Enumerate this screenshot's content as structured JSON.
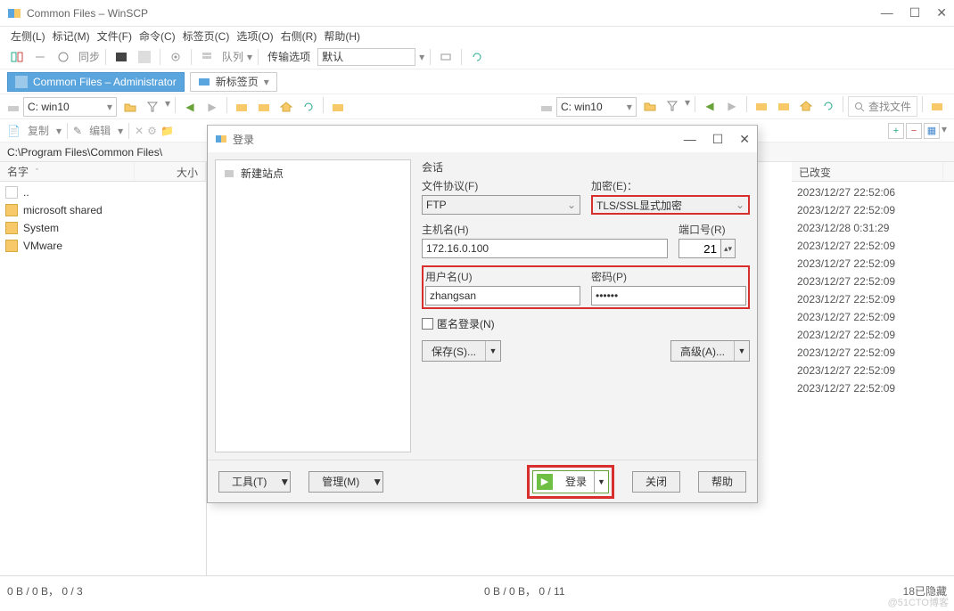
{
  "window": {
    "title": "Common Files – WinSCP"
  },
  "menu": {
    "left": "左侧(L)",
    "mark": "标记(M)",
    "file": "文件(F)",
    "cmd": "命令(C)",
    "tabs": "标签页(C)",
    "options": "选项(O)",
    "right": "右侧(R)",
    "help": "帮助(H)"
  },
  "toolbar": {
    "sync": "同步",
    "queue": "队列",
    "transfer_label": "传输选项",
    "transfer_value": "默认"
  },
  "session_tabs": {
    "active": "Common Files – Administrator",
    "new": "新标签页"
  },
  "drive_left": "C: win10",
  "drive_right": "C: win10",
  "find_files": "查找文件",
  "subtoolbar": {
    "copy": "复制",
    "edit": "编辑"
  },
  "path_left": "C:\\Program Files\\Common Files\\",
  "grid_headers": {
    "name": "名字",
    "size": "大小",
    "changed": "已改变"
  },
  "left_files": [
    {
      "name": "..",
      "type": "up"
    },
    {
      "name": "microsoft shared",
      "type": "folder"
    },
    {
      "name": "System",
      "type": "folder"
    },
    {
      "name": "VMware",
      "type": "folder"
    }
  ],
  "right_dates": [
    "2023/12/27 22:52:06",
    "2023/12/27 22:52:09",
    "2023/12/28 0:31:29",
    "2023/12/27 22:52:09",
    "2023/12/27 22:52:09",
    "2023/12/27 22:52:09",
    "2023/12/27 22:52:09",
    "2023/12/27 22:52:09",
    "2023/12/27 22:52:09",
    "2023/12/27 22:52:09",
    "2023/12/27 22:52:09",
    "2023/12/27 22:52:09"
  ],
  "status": {
    "left": "0 B / 0 B， 0 / 3",
    "right": "0 B / 0 B， 0 / 11",
    "hidden": "18已隐藏"
  },
  "watermark": "@51CTO博客",
  "dialog": {
    "title": "登录",
    "new_site": "新建站点",
    "session": "会话",
    "protocol_label": "文件协议(F)",
    "protocol_value": "FTP",
    "encryption_label": "加密(E)：",
    "encryption_value": "TLS/SSL显式加密",
    "host_label": "主机名(H)",
    "host_value": "172.16.0.100",
    "port_label": "端口号(R)",
    "port_value": "21",
    "user_label": "用户名(U)",
    "user_value": "zhangsan",
    "pass_label": "密码(P)",
    "pass_value": "••••••",
    "anonymous": "匿名登录(N)",
    "save": "保存(S)...",
    "advanced": "高级(A)...",
    "tools": "工具(T)",
    "manage": "管理(M)",
    "login": "登录",
    "close": "关闭",
    "help": "帮助"
  }
}
